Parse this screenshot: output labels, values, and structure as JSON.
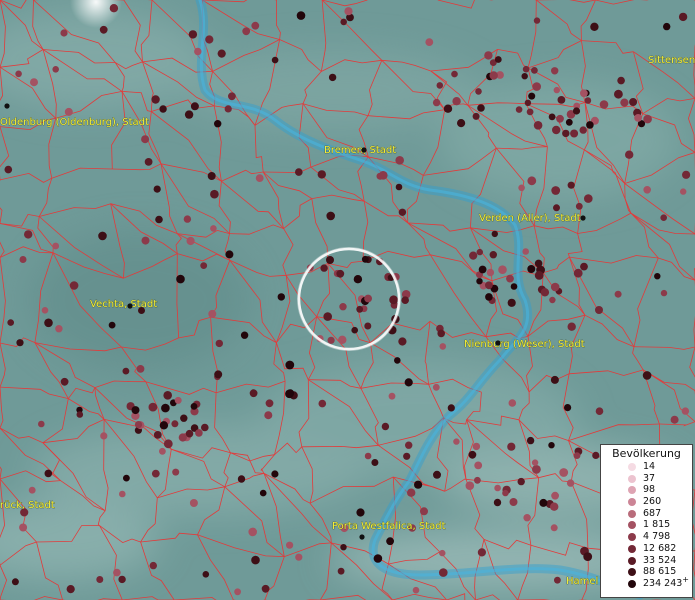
{
  "colors": {
    "terrain": "#6f9a98",
    "border": "#e23a3a",
    "river": "#2f9fd2",
    "label": "#f4ef3a",
    "selection": "#ffffff"
  },
  "cities": [
    {
      "name": "Oldenburg (Oldenburg), Stadt"
    },
    {
      "name": "Bremen, Stadt"
    },
    {
      "name": "Verden (Aller), Stadt"
    },
    {
      "name": "Vechta, Stadt"
    },
    {
      "name": "Nienburg (Weser), Stadt"
    },
    {
      "name": "Porta Westfalica, Stadt"
    },
    {
      "name": "Sittensen"
    },
    {
      "name": "rück, Stadt"
    },
    {
      "name": "Hamel"
    }
  ],
  "legend": {
    "title": "Bevölkerung",
    "items": [
      {
        "label": "14",
        "color": "#f5dbe3"
      },
      {
        "label": "37",
        "color": "#ecc3cf"
      },
      {
        "label": "98",
        "color": "#dea4b3"
      },
      {
        "label": "260",
        "color": "#cc8596"
      },
      {
        "label": "687",
        "color": "#b96c7b"
      },
      {
        "label": "1 815",
        "color": "#a45262"
      },
      {
        "label": "4 798",
        "color": "#8c3a4a"
      },
      {
        "label": "12 682",
        "color": "#732836"
      },
      {
        "label": "33 524",
        "color": "#5a1a25"
      },
      {
        "label": "88 615",
        "color": "#3d0f16"
      },
      {
        "label": "234 243",
        "color": "#22060b",
        "suffix": "+"
      }
    ]
  }
}
